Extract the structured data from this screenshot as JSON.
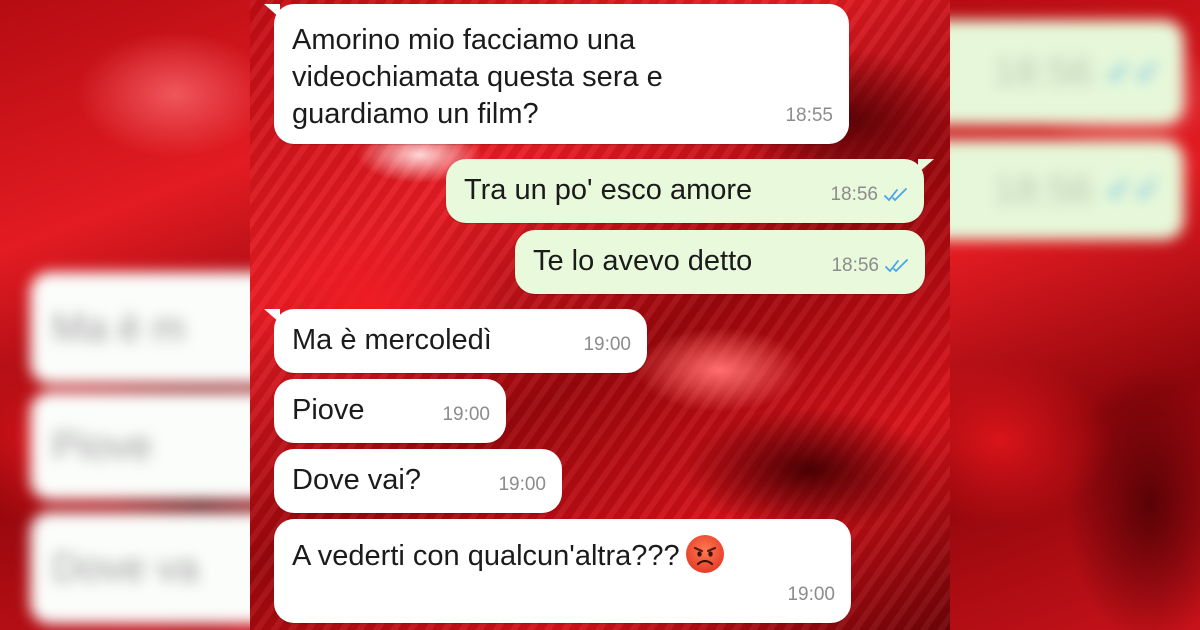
{
  "messages": [
    {
      "direction": "in",
      "text": "Amorino mio facciamo una\nvideochiamata questa sera e\nguardiamo un film?",
      "time": "18:55"
    },
    {
      "direction": "out",
      "text": "Tra un po' esco amore",
      "time": "18:56",
      "status": "read"
    },
    {
      "direction": "out",
      "text": "Te lo avevo detto",
      "time": "18:56",
      "status": "read"
    },
    {
      "direction": "in",
      "text": "Ma è mercoledì",
      "time": "19:00"
    },
    {
      "direction": "in",
      "text": "Piove",
      "time": "19:00"
    },
    {
      "direction": "in",
      "text": "Dove vai?",
      "time": "19:00"
    },
    {
      "direction": "in",
      "text": "A vederti con qualcun'altra???",
      "time": "19:00",
      "emoji": "angry-face-icon"
    }
  ],
  "blurred_left": [
    "Ma è m",
    "Piove",
    "Dove va"
  ],
  "blurred_right": [
    "18:56",
    "18:56"
  ],
  "colors": {
    "incoming_bubble": "#ffffff",
    "outgoing_bubble": "#e8f9dc",
    "timestamp": "#8c8c8c",
    "read_ticks": "#49a6e8",
    "background_red": "#d81219"
  }
}
